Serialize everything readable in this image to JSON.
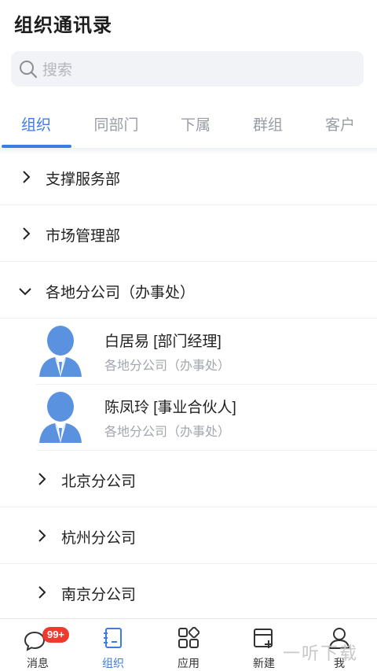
{
  "header": {
    "title": "组织通讯录"
  },
  "search": {
    "placeholder": "搜索"
  },
  "tabs": [
    {
      "label": "组织",
      "active": true
    },
    {
      "label": "同部门"
    },
    {
      "label": "下属"
    },
    {
      "label": "群组"
    },
    {
      "label": "客户"
    }
  ],
  "departments": [
    {
      "label": "支撑服务部",
      "expanded": false
    },
    {
      "label": "市场管理部",
      "expanded": false
    },
    {
      "label": "各地分公司（办事处）",
      "expanded": true
    }
  ],
  "members": [
    {
      "name": "白居易 [部门经理]",
      "dept": "各地分公司（办事处）"
    },
    {
      "name": "陈凤玲 [事业合伙人]",
      "dept": "各地分公司（办事处）"
    }
  ],
  "subdepartments": [
    {
      "label": "北京分公司"
    },
    {
      "label": "杭州分公司"
    },
    {
      "label": "南京分公司"
    }
  ],
  "bottom_nav": [
    {
      "label": "消息",
      "icon": "message-icon",
      "badge": "99+"
    },
    {
      "label": "组织",
      "icon": "contacts-book-icon",
      "active": true
    },
    {
      "label": "应用",
      "icon": "apps-grid-icon"
    },
    {
      "label": "新建",
      "icon": "new-document-icon"
    },
    {
      "label": "我",
      "icon": "profile-icon"
    }
  ],
  "colors": {
    "accent": "#3d7be5",
    "badge": "#ee3b30",
    "avatar": "#5b92e0"
  },
  "watermark": "一听下载"
}
